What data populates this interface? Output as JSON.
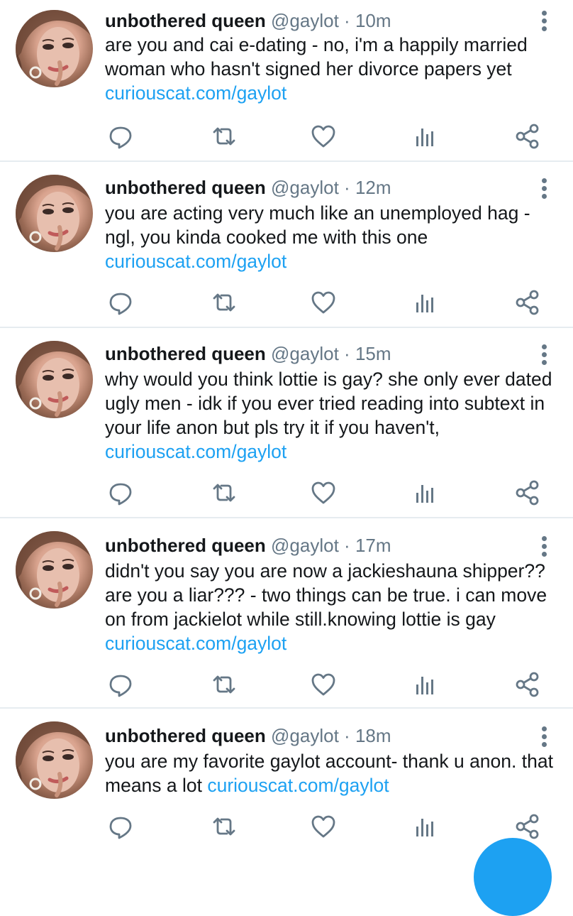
{
  "colors": {
    "link": "#1da1f2",
    "muted": "#657786",
    "divider": "#e6ecf0"
  },
  "icons": {
    "more": "more-vertical-icon",
    "reply": "reply-icon",
    "retweet": "retweet-icon",
    "like": "heart-icon",
    "stats": "analytics-icon",
    "share": "share-icon"
  },
  "tweets": [
    {
      "name": "unbothered queen",
      "handle": "@gaylot",
      "separator": "·",
      "time": "10m",
      "text": "are you and cai e-dating - no, i'm a happily married woman who hasn't signed her divorce papers yet ",
      "link": "curiouscat.com/gaylot"
    },
    {
      "name": "unbothered queen",
      "handle": "@gaylot",
      "separator": "·",
      "time": "12m",
      "text": "you are acting very much like an unemployed hag - ngl, you kinda cooked me with this one ",
      "link": "curiouscat.com/gaylot"
    },
    {
      "name": "unbothered queen",
      "handle": "@gaylot",
      "separator": "·",
      "time": "15m",
      "text": "why would you think lottie is gay? she only ever dated ugly men - idk if you ever tried reading into subtext in your life anon but pls try it if you haven't, ",
      "link": "curiouscat.com/gaylot"
    },
    {
      "name": "unbothered queen",
      "handle": "@gaylot",
      "separator": "·",
      "time": "17m",
      "text": "didn't you say you are now a jackieshauna shipper?? are you a liar??? - two things can be true. i can move on from jackielot while still.knowing lottie is gay ",
      "link": "curiouscat.com/gaylot"
    },
    {
      "name": "unbothered queen",
      "handle": "@gaylot",
      "separator": "·",
      "time": "18m",
      "text": "you are my favorite gaylot account- thank u anon. that means a lot ",
      "link": "curiouscat.com/gaylot"
    }
  ]
}
